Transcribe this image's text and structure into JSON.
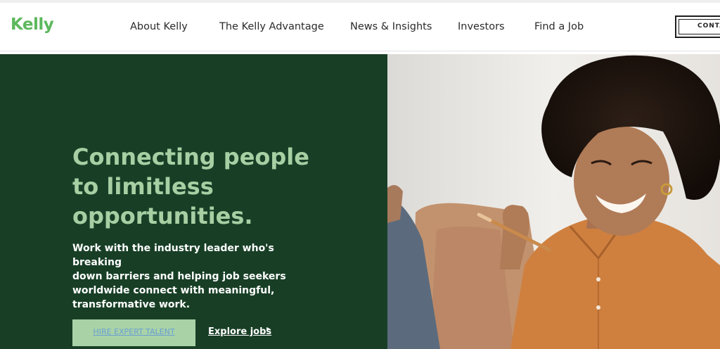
{
  "header": {
    "logo": "Kelly",
    "nav": [
      "About Kelly",
      "The Kelly Advantage",
      "News & Insights",
      "Investors",
      "Find a Job"
    ],
    "contact_label": "CONTA"
  },
  "hero": {
    "headline_lines": [
      "Connecting people",
      "to limitless",
      "opportunities."
    ],
    "subcopy_lines": [
      "Work with the industry leader who's breaking",
      "down barriers and helping job seekers",
      "worldwide connect with meaningful,",
      "transformative work."
    ],
    "primary_cta": "HIRE EXPERT TALENT",
    "secondary_cta": "Explore jobs",
    "arrow_glyph": "▸"
  },
  "colors": {
    "brand_green": "#5cb85c",
    "hero_bg": "#183f26",
    "headline": "#a7cfa3",
    "cta_bg": "#a9d3a7",
    "cta_text": "#6a9ed3"
  },
  "icons": {
    "explore_arrow": "chevron-right-icon"
  }
}
